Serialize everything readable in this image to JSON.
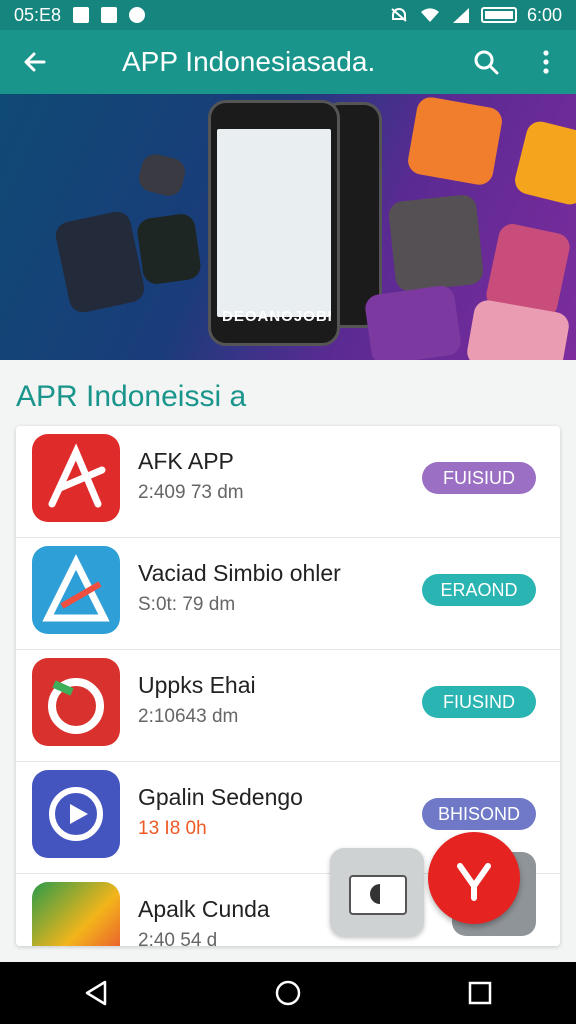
{
  "status_bar": {
    "left_text": "05:E8",
    "time": "6:00"
  },
  "app_bar": {
    "title": "APP Indonesiasada."
  },
  "banner": {
    "phone_text": "DEOANOJOBI"
  },
  "section": {
    "title": "APR Indoneissi a"
  },
  "apps": [
    {
      "name": "AFK APP",
      "sub": "2:409 73 dm",
      "button": "FUISIUD",
      "button_color": "#9b6fc4",
      "icon_color": "#e02b2b"
    },
    {
      "name": "Vaciad Simbio ohler",
      "sub": "S:0t: 79 dm",
      "button": "ERAOND",
      "button_color": "#2ab5b2",
      "icon_color": "#2f9fd8"
    },
    {
      "name": "Uppks Ehai",
      "sub": "2:10643 dm",
      "button": "FIUSIND",
      "button_color": "#2ab5b2",
      "icon_color": "#d9322e"
    },
    {
      "name": "Gpalin Sedengo",
      "sub": "13 I8 0h",
      "button": "BHISOND",
      "button_color": "#6f79c7",
      "icon_color": "#4455c0",
      "sub_color": "#ee5a24"
    },
    {
      "name": "Apalk Cunda",
      "sub": "2:40 54 d",
      "button": "",
      "button_color": "#2ab5b2",
      "icon_color": "#2c9b4a"
    }
  ],
  "colors": {
    "primary": "#1a958c",
    "status": "#15857d",
    "fab": "#e52421"
  },
  "icons": [
    "back-arrow-icon",
    "search-icon",
    "more-vert-icon",
    "nav-back-icon",
    "nav-home-icon",
    "nav-recents-icon"
  ]
}
